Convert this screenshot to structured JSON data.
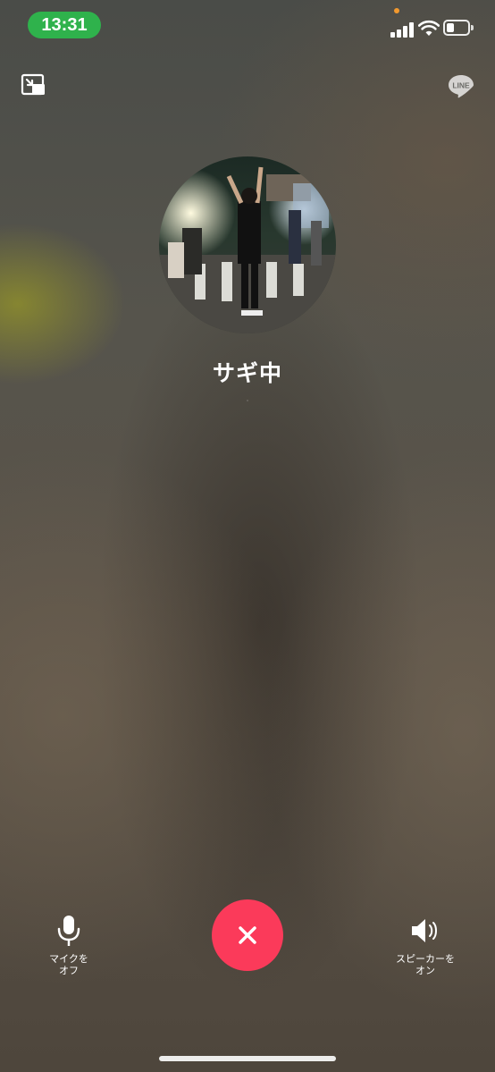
{
  "status_bar": {
    "time": "13:31"
  },
  "contact": {
    "name": "サギ中",
    "status": "·"
  },
  "controls": {
    "mic_label": "マイクを\nオフ",
    "speaker_label": "スピーカーを\nオン"
  },
  "icons": {
    "top_left": "picture-in-picture-icon",
    "top_right": "line-logo-icon",
    "mic": "microphone-icon",
    "end_call": "close-icon",
    "speaker": "speaker-icon"
  },
  "colors": {
    "time_pill": "#2fb24c",
    "end_call": "#fb3a5a",
    "orange_dot": "#f2992e"
  }
}
